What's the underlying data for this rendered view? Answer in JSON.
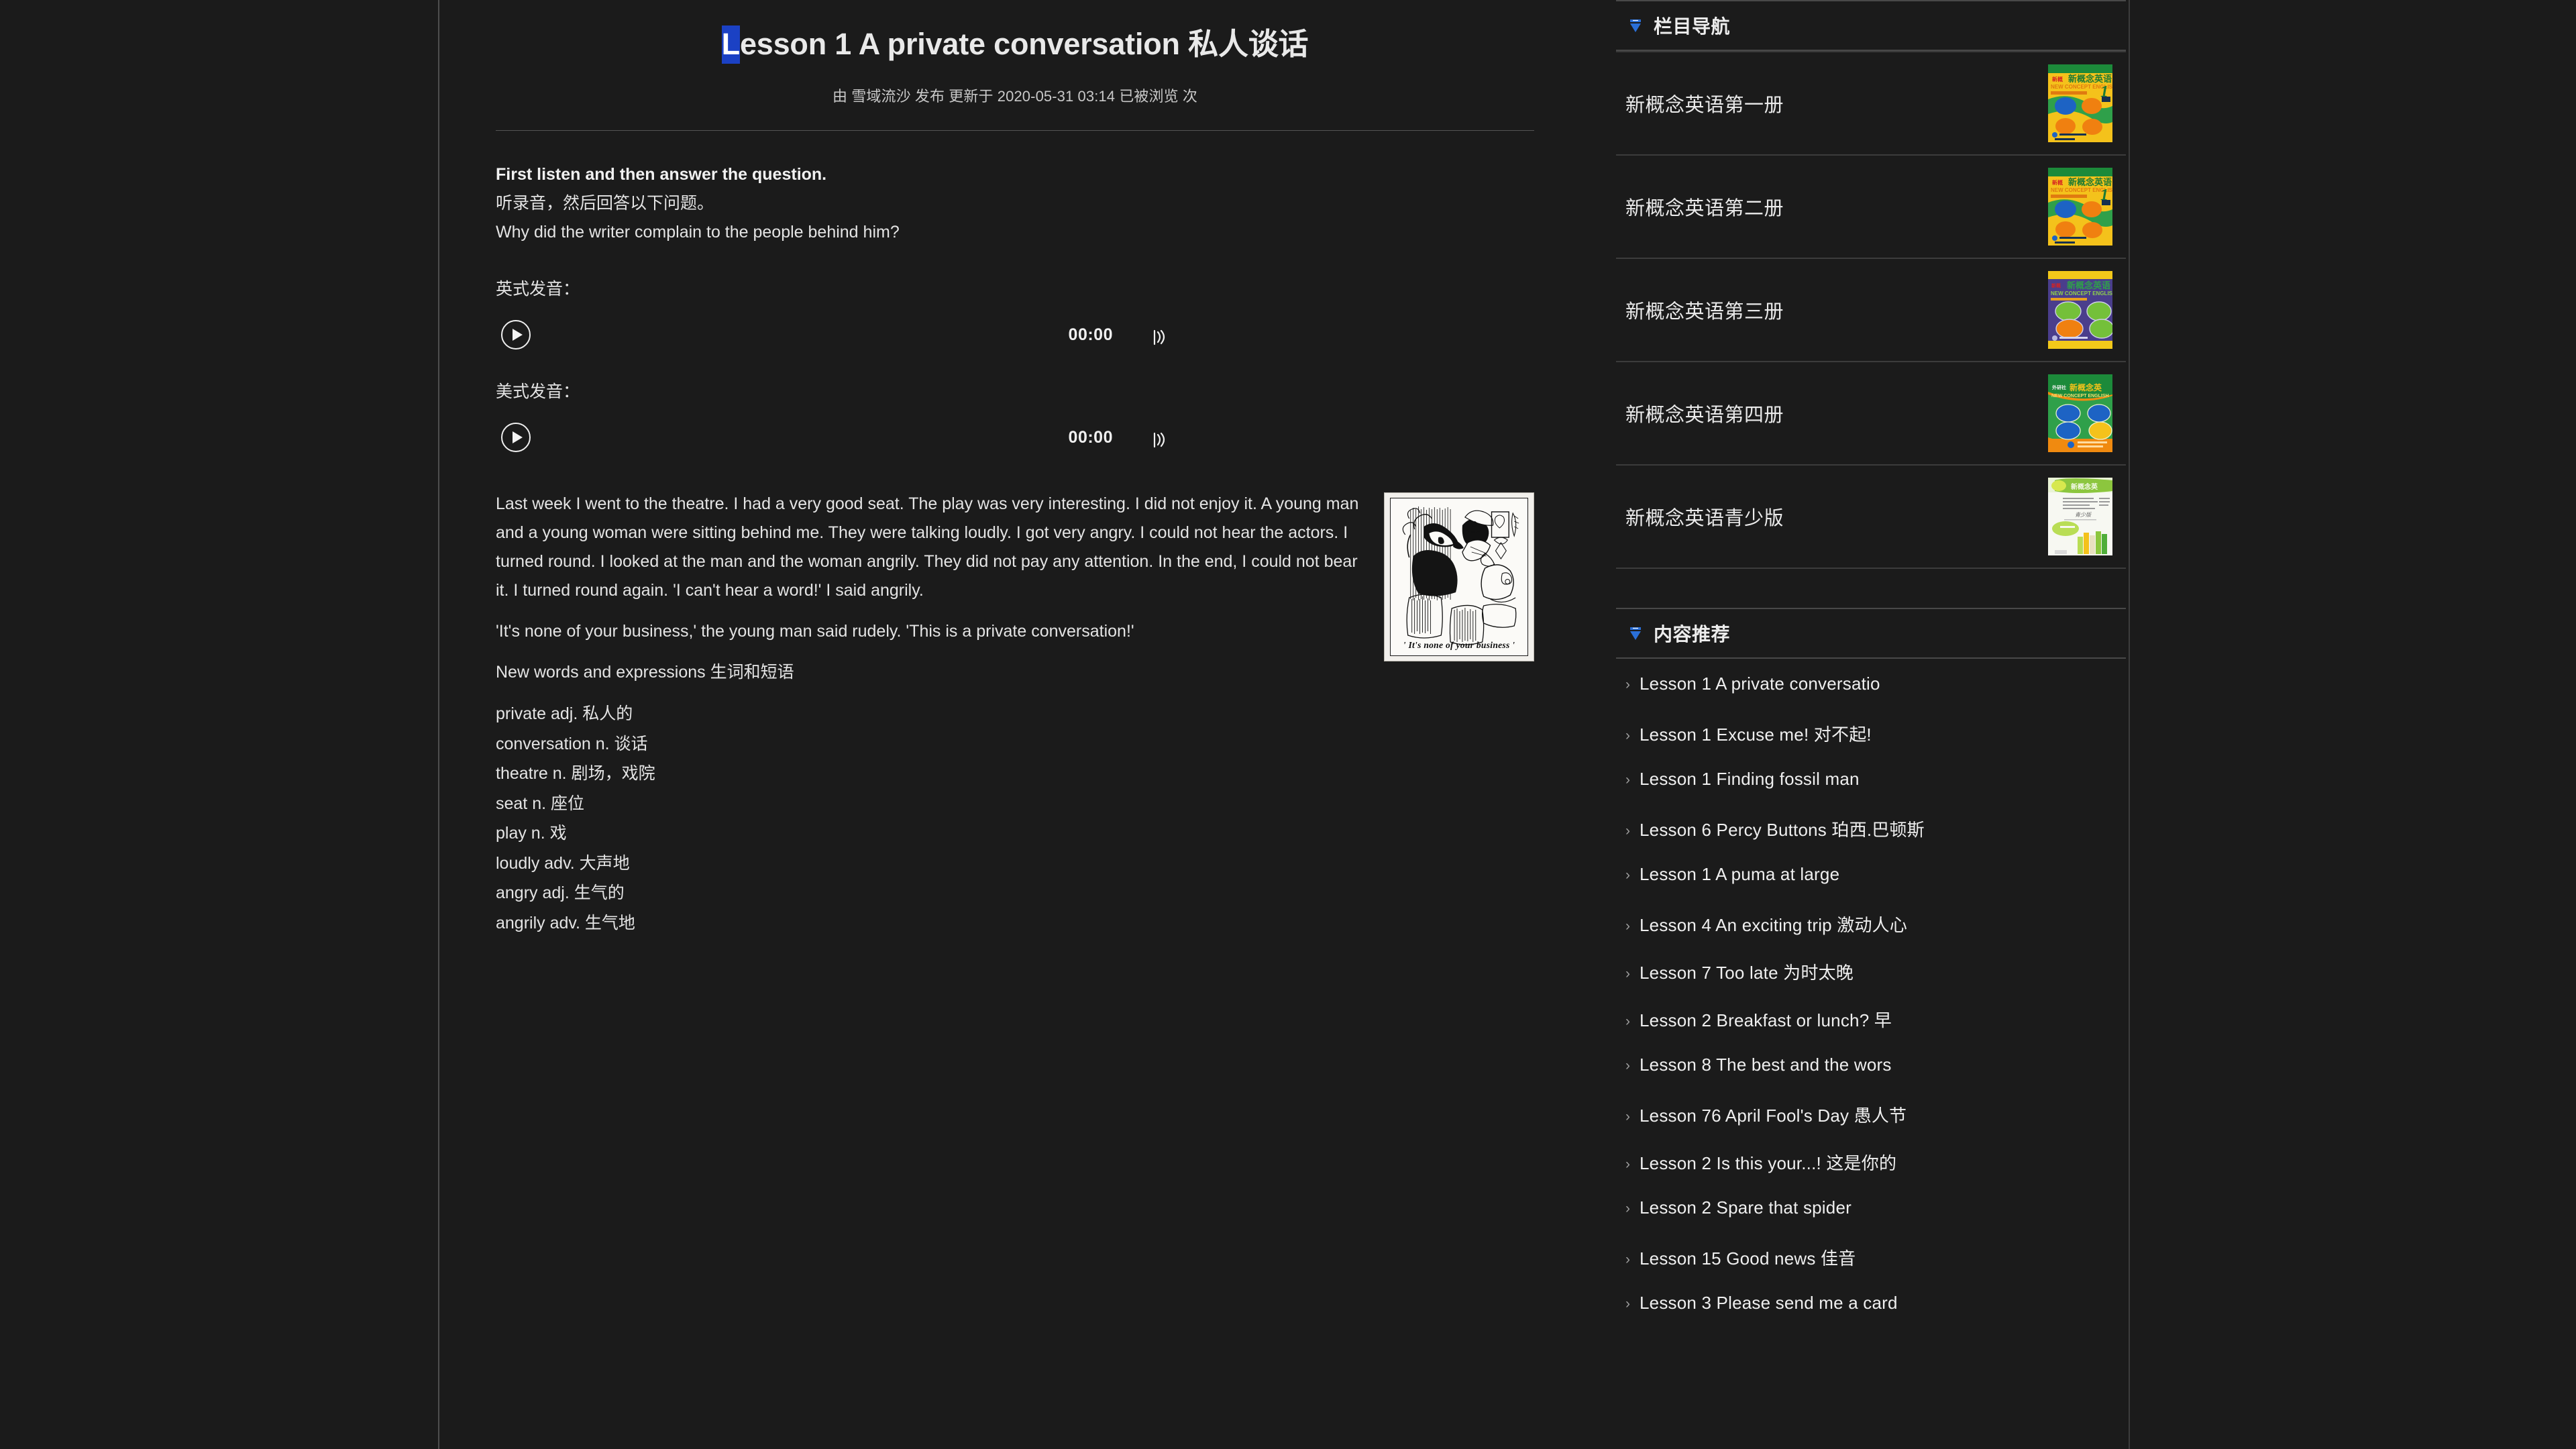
{
  "article": {
    "title_highlight": "L",
    "title_rest": "esson 1 A private conversation 私人谈话",
    "meta": "由 雪域流沙 发布 更新于 2020-05-31 03:14 已被浏览  次",
    "lead_en": "First listen and then answer the question.",
    "lead_zh": "听录音，然后回答以下问题。",
    "question": "Why did the writer complain to the people behind him?",
    "audio_british_label": "英式发音：",
    "audio_american_label": "美式发音：",
    "audio_time": "00:00",
    "figure_caption": "' It's none of your business '",
    "paragraph_1": "Last week I went to the theatre. I had a very good seat. The play was very interesting. I did not enjoy it. A young man and a young woman were sitting behind me. They were talking loudly. I got very angry. I could not hear the actors. I turned round. I looked at the man and the woman angrily. They did not pay any attention. In the end, I could not bear it. I turned round again. 'I can't hear a word!' I said angrily.",
    "paragraph_2": "'It's none of your business,' the young man said rudely. 'This is a private conversation!'",
    "words_heading": "New words and expressions 生词和短语",
    "words": [
      "private adj. 私人的",
      "conversation n. 谈话",
      "theatre n. 剧场，戏院",
      "seat n. 座位",
      "play n. 戏",
      "loudly adv. 大声地",
      "angry adj. 生气的",
      "angrily adv. 生气地"
    ]
  },
  "sidebar": {
    "nav_panel": {
      "title": "栏目导航",
      "items": [
        {
          "label": "新概念英语第一册",
          "cover": "book1"
        },
        {
          "label": "新概念英语第二册",
          "cover": "book2"
        },
        {
          "label": "新概念英语第三册",
          "cover": "book3"
        },
        {
          "label": "新概念英语第四册",
          "cover": "book4"
        },
        {
          "label": "新概念英语青少版",
          "cover": "book5"
        }
      ]
    },
    "rec_panel": {
      "title": "内容推荐",
      "bullet": "›",
      "items": [
        "Lesson 1 A private conversatio",
        "Lesson 1 Excuse me! 对不起!",
        "Lesson 1 Finding fossil man",
        "Lesson 6 Percy Buttons 珀西.巴顿斯",
        "Lesson 1 A puma at large",
        "Lesson 4 An exciting trip 激动人心",
        "Lesson 7 Too late 为时太晚",
        "Lesson 2 Breakfast or lunch? 早",
        "Lesson 8 The best and the wors",
        "Lesson 76 April Fool's Day 愚人节",
        "Lesson 2 Is this your...! 这是你的",
        "Lesson 2 Spare that spider",
        "Lesson 15 Good news 佳音",
        "Lesson 3 Please send me a card"
      ]
    }
  },
  "theme": {
    "background": "#1b1b1b",
    "text": "#e9e9e9",
    "accent": "#2a6fd8",
    "selection": "#1b41c4",
    "divider": "#494949"
  }
}
